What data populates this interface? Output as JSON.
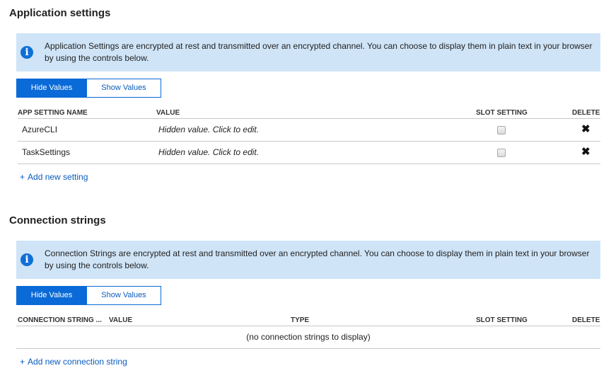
{
  "app_settings": {
    "title": "Application settings",
    "info": "Application Settings are encrypted at rest and transmitted over an encrypted channel. You can choose to display them in plain text in your browser by using the controls below.",
    "hide_label": "Hide Values",
    "show_label": "Show Values",
    "columns": {
      "name": "APP SETTING NAME",
      "value": "VALUE",
      "slot": "SLOT SETTING",
      "delete": "DELETE"
    },
    "rows": [
      {
        "name": "AzureCLI",
        "value": "Hidden value. Click to edit.",
        "slot_setting": false
      },
      {
        "name": "TaskSettings",
        "value": "Hidden value. Click to edit.",
        "slot_setting": false
      }
    ],
    "add_plus": "+",
    "add_label": "Add new setting"
  },
  "conn_strings": {
    "title": "Connection strings",
    "info": "Connection Strings are encrypted at rest and transmitted over an encrypted channel. You can choose to display them in plain text in your browser by using the controls below.",
    "hide_label": "Hide Values",
    "show_label": "Show Values",
    "columns": {
      "name": "CONNECTION STRING ...",
      "value": "VALUE",
      "type": "TYPE",
      "slot": "SLOT SETTING",
      "delete": "DELETE"
    },
    "empty": "(no connection strings to display)",
    "add_plus": "+",
    "add_label": "Add new connection string"
  },
  "icons": {
    "info": "i",
    "delete": "✖"
  },
  "colors": {
    "accent": "#0a6ad7",
    "info_bg": "#cfe4f7",
    "link": "#0a5bbd"
  }
}
